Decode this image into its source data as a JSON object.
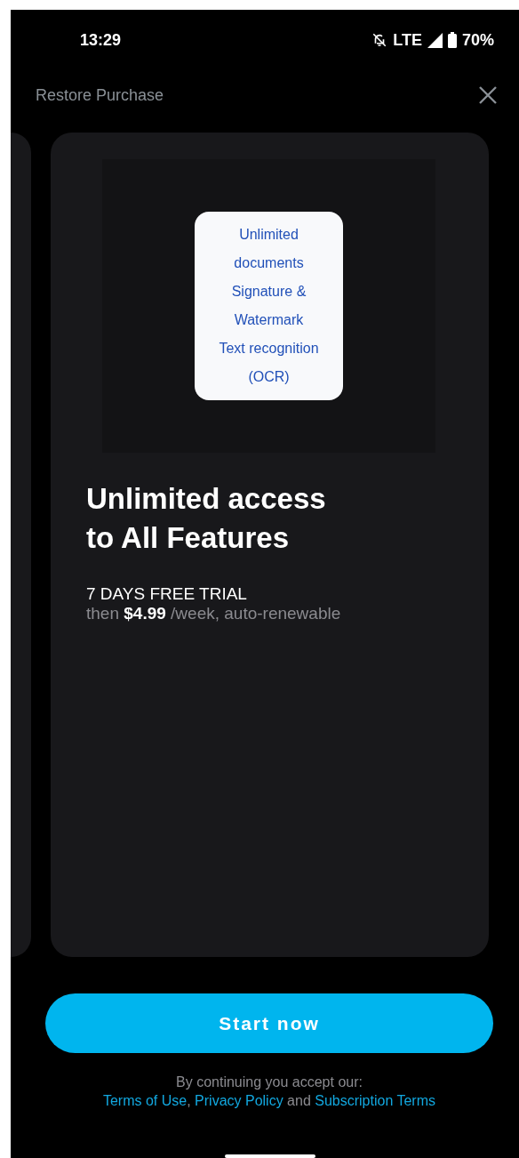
{
  "status_bar": {
    "time": "13:29",
    "network": "LTE",
    "battery": "70%"
  },
  "header": {
    "restore": "Restore Purchase"
  },
  "card": {
    "features": [
      "Unlimited",
      "documents",
      "Signature &",
      "Watermark",
      "Text recognition",
      "(OCR)"
    ],
    "title": [
      "Unlimited access",
      "to All Features"
    ],
    "trial": "7 DAYS FREE TRIAL",
    "price": "then **$4.99** /week, auto-renewable"
  },
  "button": "Start now",
  "legal": {
    "intro": "By continuing you accept our:",
    "parts": [
      {
        "kind": "link",
        "text": "Terms of Use",
        "after": ", "
      },
      {
        "kind": "link",
        "text": "Privacy Policy",
        "after": " and "
      },
      {
        "kind": "link",
        "text": "Subscription Terms"
      }
    ]
  }
}
